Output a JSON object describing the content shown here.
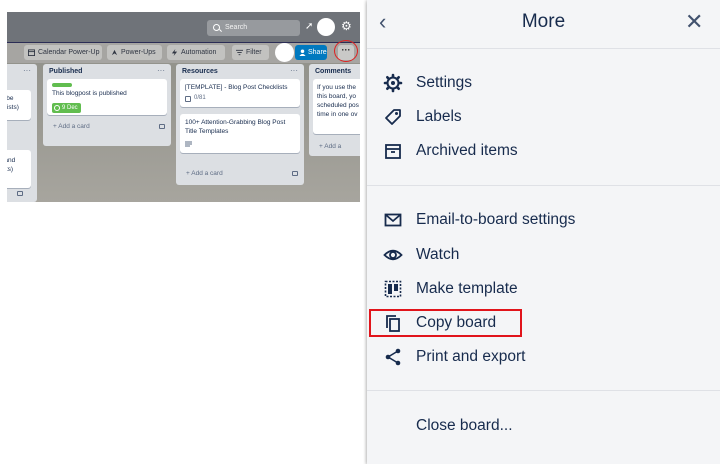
{
  "board": {
    "topbar": {
      "search_label": "Search",
      "icons": [
        "search-icon",
        "rocket-icon",
        "avatar",
        "gear-icon"
      ]
    },
    "toolbar": {
      "calendar_label": "Calendar Power-Up",
      "powerups_label": "Power-Ups",
      "automation_label": "Automation",
      "filter_label": "Filter",
      "share_label": "Share",
      "more_label": "···"
    },
    "partial_list": {
      "menu": "···",
      "card1_line1": "to be",
      "card1_line2": "cklists)",
      "card2_line1": "d and",
      "card2_line2": "(ists)"
    },
    "published": {
      "title": "Published",
      "menu": "···",
      "card_text": "This blogpost is published",
      "due_badge": "9 Dec",
      "label_color": "#61bd4f",
      "add_card": "+ Add a card"
    },
    "resources": {
      "title": "Resources",
      "menu": "···",
      "card1_text": "[TEMPLATE] - Blog Post Checklists",
      "card1_badge": "0/81",
      "card2_line1": "100+ Attention-Grabbing Blog Post",
      "card2_line2": "Title Templates",
      "add_card": "+ Add a card"
    },
    "comments": {
      "title": "Comments",
      "lines": [
        "If you use the",
        "this board, yo",
        "scheduled pos",
        "time in one ov"
      ],
      "add_card": "+ Add a"
    },
    "accent_color": "#0079bf",
    "annotation_color": "#e02020"
  },
  "panel": {
    "title": "More",
    "back_icon": "chevron-left-icon",
    "close_icon": "close-icon",
    "group1": [
      {
        "label": "Settings",
        "icon": "gear-icon"
      },
      {
        "label": "Labels",
        "icon": "tag-icon"
      },
      {
        "label": "Archived items",
        "icon": "archive-icon"
      }
    ],
    "group2": [
      {
        "label": "Email-to-board settings",
        "icon": "mail-icon"
      },
      {
        "label": "Watch",
        "icon": "eye-icon"
      },
      {
        "label": "Make template",
        "icon": "template-icon"
      },
      {
        "label": "Copy board",
        "icon": "copy-icon"
      },
      {
        "label": "Print and export",
        "icon": "share-icon"
      }
    ],
    "close_board_label": "Close board...",
    "highlight_color": "#e1141b"
  }
}
